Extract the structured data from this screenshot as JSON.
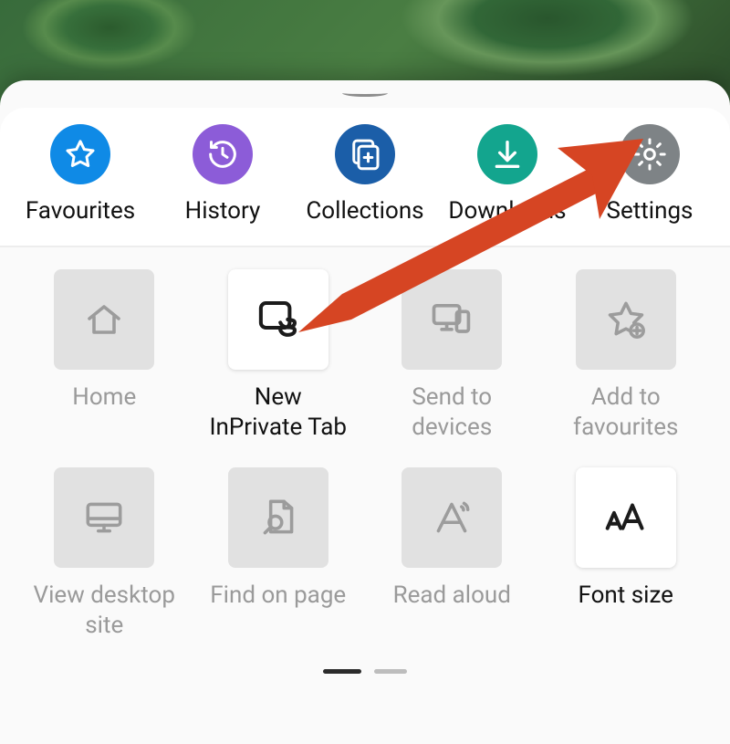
{
  "top": {
    "favourites": {
      "label": "Favourites"
    },
    "history": {
      "label": "History"
    },
    "collections": {
      "label": "Collections"
    },
    "downloads": {
      "label": "Downloads"
    },
    "settings": {
      "label": "Settings"
    }
  },
  "grid": {
    "home": {
      "label": "Home"
    },
    "new_inprivate": {
      "label": "New\nInPrivate Tab"
    },
    "send_devices": {
      "label": "Send to\ndevices"
    },
    "add_fav": {
      "label": "Add to\nfavourites"
    },
    "view_desktop": {
      "label": "View desktop\nsite"
    },
    "find_on_page": {
      "label": "Find on page"
    },
    "read_aloud": {
      "label": "Read aloud"
    },
    "font_size": {
      "label": "Font size"
    }
  },
  "pager": {
    "current_index": 0,
    "count": 2
  }
}
